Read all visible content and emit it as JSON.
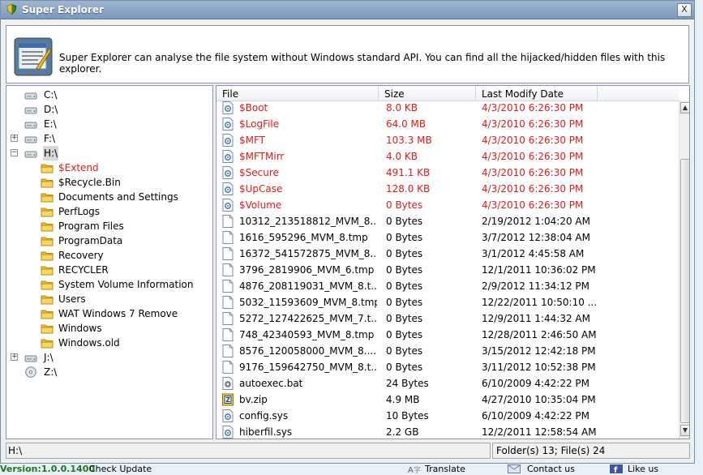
{
  "window": {
    "title": "Super Explorer",
    "close_label": "X"
  },
  "banner": {
    "description": "Super Explorer can analyse the file system without Windows standard API. You can find all the hijacked/hidden files with this explorer."
  },
  "tree": {
    "nodes": [
      {
        "label": "C:\\",
        "kind": "drive-icon"
      },
      {
        "label": "D:\\",
        "kind": "drive-icon"
      },
      {
        "label": "E:\\",
        "kind": "drive-icon"
      },
      {
        "label": "F:\\",
        "kind": "drive-icon",
        "expander": "+"
      },
      {
        "label": "H:\\",
        "kind": "drive-icon",
        "expander": "−",
        "selected": true
      },
      {
        "label": "$Extend",
        "kind": "folder-icon",
        "red": true
      },
      {
        "label": "$Recycle.Bin",
        "kind": "folder-icon"
      },
      {
        "label": "Documents and Settings",
        "kind": "folder-icon"
      },
      {
        "label": "PerfLogs",
        "kind": "folder-icon"
      },
      {
        "label": "Program Files",
        "kind": "folder-icon"
      },
      {
        "label": "ProgramData",
        "kind": "folder-icon"
      },
      {
        "label": "Recovery",
        "kind": "folder-icon"
      },
      {
        "label": "RECYCLER",
        "kind": "folder-icon"
      },
      {
        "label": "System Volume Information",
        "kind": "folder-icon"
      },
      {
        "label": "Users",
        "kind": "folder-icon"
      },
      {
        "label": "WAT Windows 7 Remove",
        "kind": "folder-icon"
      },
      {
        "label": "Windows",
        "kind": "folder-icon"
      },
      {
        "label": "Windows.old",
        "kind": "folder-icon"
      },
      {
        "label": "J:\\",
        "kind": "drive-icon",
        "expander": "+"
      },
      {
        "label": "Z:\\",
        "kind": "cd-icon"
      }
    ]
  },
  "list": {
    "columns": [
      "File",
      "Size",
      "Last Modify Date"
    ],
    "rows": [
      {
        "name": "$Boot",
        "size": "8.0 KB",
        "date": "4/3/2010 6:26:30 PM",
        "red": true,
        "icon": "system-file-icon"
      },
      {
        "name": "$LogFile",
        "size": "64.0 MB",
        "date": "4/3/2010 6:26:30 PM",
        "red": true,
        "icon": "system-file-icon"
      },
      {
        "name": "$MFT",
        "size": "103.3 MB",
        "date": "4/3/2010 6:26:30 PM",
        "red": true,
        "icon": "system-file-icon"
      },
      {
        "name": "$MFTMirr",
        "size": "4.0 KB",
        "date": "4/3/2010 6:26:30 PM",
        "red": true,
        "icon": "system-file-icon"
      },
      {
        "name": "$Secure",
        "size": "491.1 KB",
        "date": "4/3/2010 6:26:30 PM",
        "red": true,
        "icon": "system-file-icon"
      },
      {
        "name": "$UpCase",
        "size": "128.0 KB",
        "date": "4/3/2010 6:26:30 PM",
        "red": true,
        "icon": "system-file-icon"
      },
      {
        "name": "$Volume",
        "size": "0 Bytes",
        "date": "4/3/2010 6:26:30 PM",
        "red": true,
        "icon": "system-file-icon"
      },
      {
        "name": "10312_213518812_MVM_8....",
        "size": "0 Bytes",
        "date": "2/19/2012 1:04:20 AM",
        "icon": "file-icon"
      },
      {
        "name": "1616_595296_MVM_8.tmp",
        "size": "0 Bytes",
        "date": "3/7/2012 12:38:04 AM",
        "icon": "file-icon"
      },
      {
        "name": "16372_541572875_MVM_8....",
        "size": "0 Bytes",
        "date": "3/1/2012 4:45:58 AM",
        "icon": "file-icon"
      },
      {
        "name": "3796_2819906_MVM_6.tmp",
        "size": "0 Bytes",
        "date": "12/1/2011 10:36:02 PM",
        "icon": "file-icon"
      },
      {
        "name": "4876_208119031_MVM_8.t...",
        "size": "0 Bytes",
        "date": "2/9/2012 11:34:12 PM",
        "icon": "file-icon"
      },
      {
        "name": "5032_11593609_MVM_8.tmp",
        "size": "0 Bytes",
        "date": "12/22/2011 10:50:10 ...",
        "icon": "file-icon"
      },
      {
        "name": "5272_127422625_MVM_7.t...",
        "size": "0 Bytes",
        "date": "12/9/2011 1:44:32 AM",
        "icon": "file-icon"
      },
      {
        "name": "748_42340593_MVM_8.tmp",
        "size": "0 Bytes",
        "date": "12/28/2011 2:46:50 AM",
        "icon": "file-icon"
      },
      {
        "name": "8576_120058000_MVM_8....",
        "size": "0 Bytes",
        "date": "3/15/2012 12:42:18 PM",
        "icon": "file-icon"
      },
      {
        "name": "9176_159642750_MVM_8.t...",
        "size": "0 Bytes",
        "date": "3/11/2012 10:52:38 PM",
        "icon": "file-icon"
      },
      {
        "name": "autoexec.bat",
        "size": "24 Bytes",
        "date": "6/10/2009 4:42:22 PM",
        "icon": "gear-file-icon"
      },
      {
        "name": "bv.zip",
        "size": "4.9 MB",
        "date": "4/27/2010 10:35:04 PM",
        "icon": "zip-file-icon"
      },
      {
        "name": "config.sys",
        "size": "10 Bytes",
        "date": "6/10/2009 4:42:22 PM",
        "icon": "system-file-icon"
      },
      {
        "name": "hiberfil.sys",
        "size": "2.2 GB",
        "date": "12/2/2011 12:58:54 AM",
        "icon": "system-file-icon"
      }
    ]
  },
  "status": {
    "path": "H:\\",
    "counts": "Folder(s) 13; File(s) 24"
  },
  "footer": {
    "version": "Version:1.0.0.1400",
    "check_update": "Check Update",
    "translate": "Translate",
    "contact": "Contact us",
    "like": "Like us"
  },
  "colors": {
    "hidden_text": "#e01a1a",
    "titlebar": "#8aa5c6",
    "version_text": "#1a7a1a"
  }
}
